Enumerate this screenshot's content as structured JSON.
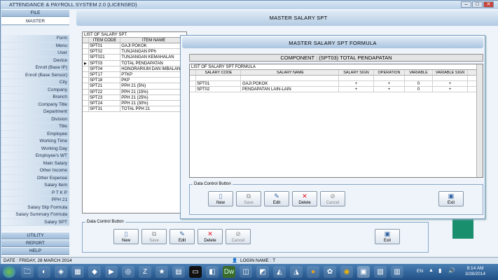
{
  "app": {
    "title": "ATTENDANCE & PAYROLL SYSTEM 2.0 (LICENSED)"
  },
  "sidebar": {
    "file": "FILE",
    "master": "MASTER",
    "items": [
      "Form",
      "Menu",
      "User",
      "Device",
      "Enroll (Base IP)",
      "Enroll (Base Sensor)",
      "City",
      "Company",
      "Branch",
      "Company Title",
      "Department",
      "Division",
      "Title",
      "Employee",
      "Working Time",
      "Working Day",
      "Employee's WT",
      "Main Salary",
      "Other Income",
      "Other Expense",
      "Salary Item",
      "P T K P",
      "PPH 21",
      "Salary Slip Formula",
      "Salary Summary Formula",
      "Salary SPT"
    ],
    "utility": "UTILITY",
    "report": "REPORT",
    "help": "HELP"
  },
  "form1": {
    "title": "MASTER SALARY SPT",
    "list_caption": "LIST OF SALARY SPT",
    "columns": [
      "ITEM CODE",
      "ITEM NAME"
    ],
    "rows": [
      [
        "SPT01",
        "GAJI POKOK"
      ],
      [
        "SPT02",
        "TUNJANGAN PPh"
      ],
      [
        "SPT021",
        "TUNJANGAN KEMAHALAN"
      ],
      [
        "SPT03",
        "TOTAL PENDAPATAN"
      ],
      [
        "SPT04",
        "HONORARIUM DAN IMBALAN LAIN"
      ],
      [
        "SPT17",
        "PTKP"
      ],
      [
        "SPT18",
        "PKP"
      ],
      [
        "SPT21",
        "PPH 21 (5%)"
      ],
      [
        "SPT22",
        "PPH 21 (15%)"
      ],
      [
        "SPT23",
        "PPH 21 (25%)"
      ],
      [
        "SPT24",
        "PPH 21 (30%)"
      ],
      [
        "SPT31",
        "TOTAL PPH 21"
      ]
    ],
    "selected_row": 3,
    "control_label": "Data Control Button",
    "buttons": {
      "new": "New",
      "save": "Save",
      "edit": "Edit",
      "delete": "Delete",
      "cancel": "Cancel",
      "exit": "Exit"
    }
  },
  "form2": {
    "title": "MASTER SALARY SPT FORMULA",
    "component": "COMPONENT : (SPT03) TOTAL PENDAPATAN",
    "list_caption": "LIST OF SALARY SPT FORMULA",
    "columns": [
      "SALARY CODE",
      "SALARY NAME",
      "SALARY SIGN",
      "OPERATION",
      "VARIABLE",
      "VARIABLE SIGN"
    ],
    "rows": [
      [
        "SPT01",
        "GAJI POKOK",
        "+",
        "+",
        "0",
        "+"
      ],
      [
        "SPT02",
        "PENDAPATAN LAIN-LAIN",
        "+",
        "+",
        "0",
        "+"
      ]
    ],
    "control_label": "Data Control Button",
    "buttons": {
      "new": "New",
      "save": "Save",
      "edit": "Edit",
      "delete": "Delete",
      "cancel": "Cancel",
      "exit": "Exit"
    }
  },
  "status": {
    "date": "DATE : FRIDAY, 28 MARCH 2014",
    "login": "LOGIN NAME : T"
  },
  "taskbar": {
    "lang": "EN",
    "time": "8:14 AM",
    "date": "3/28/2014"
  }
}
